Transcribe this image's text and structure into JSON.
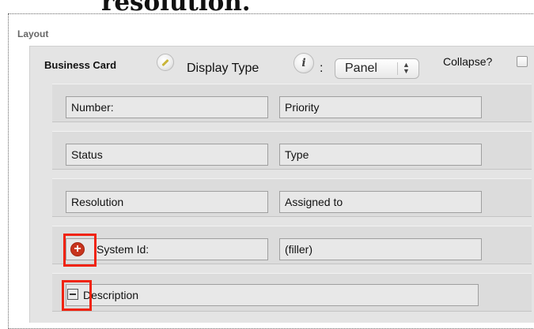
{
  "heading": {
    "cutoff_text": "resolution."
  },
  "layout_label": "Layout",
  "panel": {
    "title": "Business Card",
    "display_type_label": "Display Type",
    "info_icon_glyph": "i",
    "colon": ":",
    "display_type_value": "Panel",
    "collapse_label": "Collapse?"
  },
  "rows": [
    {
      "left": "Number:",
      "right": "Priority"
    },
    {
      "left": "Status",
      "right": "Type"
    },
    {
      "left": "Resolution",
      "right": "Assigned to"
    },
    {
      "left": "System Id:",
      "right": "(filler)"
    },
    {
      "wide": "Description"
    }
  ],
  "icons": {
    "plus_glyph": "+",
    "pencil": "pencil-icon",
    "info": "info-icon",
    "plus": "plus-icon",
    "minus": "minus-icon"
  },
  "colors": {
    "highlight": "#f0230f",
    "plus_button": "#c8341d"
  }
}
